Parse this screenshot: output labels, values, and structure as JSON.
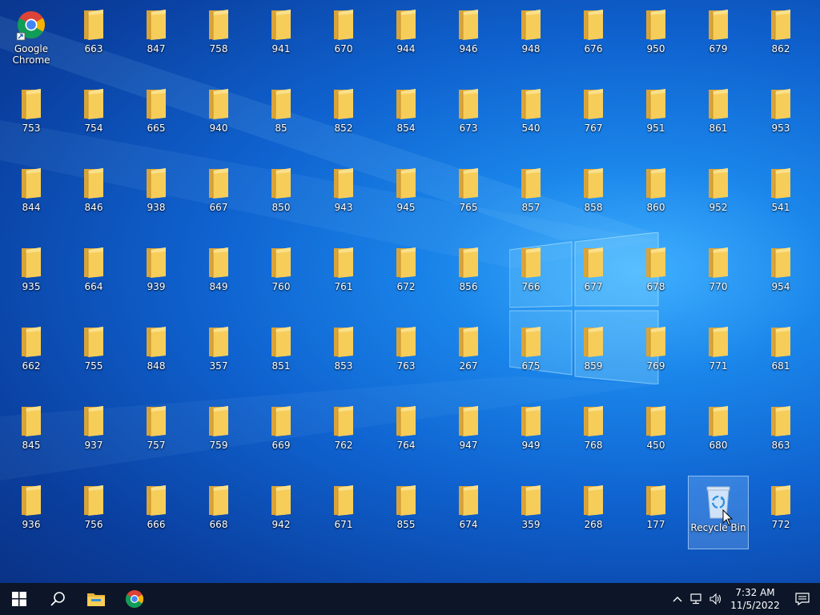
{
  "desktop": {
    "chrome_shortcut": {
      "label": "Google\nChrome",
      "icon": "chrome-icon"
    },
    "folders": [
      "663",
      "847",
      "758",
      "941",
      "670",
      "944",
      "946",
      "948",
      "676",
      "950",
      "679",
      "862",
      "753",
      "754",
      "665",
      "940",
      "85",
      "852",
      "854",
      "673",
      "540",
      "767",
      "951",
      "861",
      "953",
      "844",
      "846",
      "938",
      "667",
      "850",
      "943",
      "945",
      "765",
      "857",
      "858",
      "860",
      "952",
      "541",
      "935",
      "664",
      "939",
      "849",
      "760",
      "761",
      "672",
      "856",
      "766",
      "677",
      "678",
      "770",
      "954",
      "662",
      "755",
      "848",
      "357",
      "851",
      "853",
      "763",
      "267",
      "675",
      "859",
      "769",
      "771",
      "681",
      "845",
      "937",
      "757",
      "759",
      "669",
      "762",
      "764",
      "947",
      "949",
      "768",
      "450",
      "680",
      "863",
      "936",
      "756",
      "666",
      "668",
      "942",
      "671",
      "855",
      "674",
      "359",
      "268",
      "177",
      "772"
    ],
    "recycle_bin": {
      "label": "Recycle Bin",
      "icon": "recycle-bin-icon"
    }
  },
  "taskbar": {
    "start_icon": "windows-start-icon",
    "search_icon": "search-icon",
    "pinned": [
      {
        "name": "file-explorer",
        "icon": "file-explorer-icon"
      },
      {
        "name": "chrome",
        "icon": "chrome-icon"
      }
    ],
    "tray_icons": [
      "chevron-up-icon",
      "network-icon",
      "volume-icon"
    ],
    "time": "7:32 AM",
    "date": "11/5/2022",
    "notification_icon": "action-center-icon"
  },
  "colors": {
    "desktop_center": "#3fb0ff",
    "desktop_edge": "#0a2f80",
    "taskbar": "#0c1628",
    "folder": "#f5c445",
    "selection": "#96c8ff"
  }
}
